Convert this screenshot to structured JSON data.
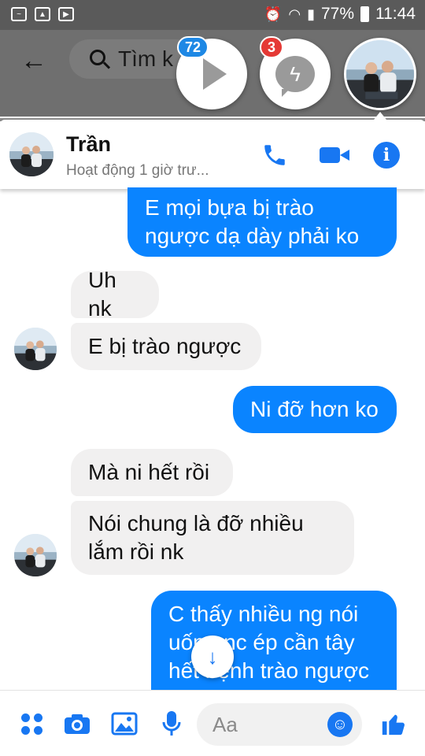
{
  "status_bar": {
    "battery": "77%",
    "time": "11:44"
  },
  "top": {
    "search_placeholder": "Tìm k",
    "badge_video": "72",
    "badge_messenger": "3"
  },
  "chat_header": {
    "name": "Trần",
    "status": "Hoạt động 1 giờ trư..."
  },
  "messages": [
    {
      "from": "me",
      "lines": [
        "E mọi bựa bị trào",
        "ngược dạ dày phải ko"
      ]
    },
    {
      "from": "them",
      "lines": [
        "Uh nk"
      ]
    },
    {
      "from": "them",
      "lines": [
        "E bị trào ngược"
      ]
    },
    {
      "from": "me",
      "lines": [
        "Ni đỡ hơn ko"
      ]
    },
    {
      "from": "them",
      "lines": [
        "Mà ni hết rồi"
      ]
    },
    {
      "from": "them",
      "lines": [
        "Nói chung là đỡ nhiều",
        "lắm rồi nk"
      ]
    },
    {
      "from": "me",
      "lines": [
        "C thấy nhiều ng nói",
        "uống nc ép cần tây",
        "hết bệnh trào ngược"
      ]
    }
  ],
  "composer": {
    "placeholder": "Aa"
  },
  "colors": {
    "messenger_blue": "#0a84ff",
    "icon_blue": "#1877f2",
    "incoming_bubble": "#f1f0f0"
  }
}
